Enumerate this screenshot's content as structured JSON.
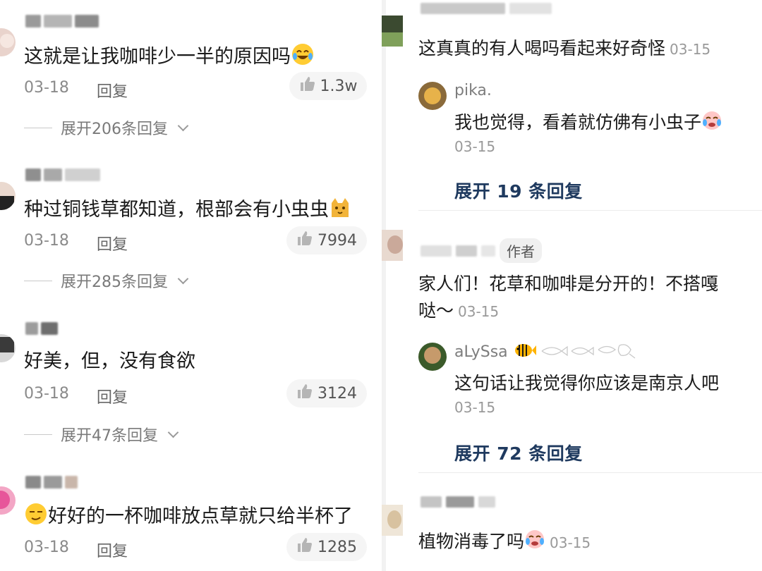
{
  "left_comments": [
    {
      "text": "这就是让我咖啡少一半的原因吗",
      "date": "03-18",
      "reply_label": "回复",
      "likes": "1.3w",
      "expand_label": "展开206条回复",
      "trailing_emoji": "laugh-cry-emoji"
    },
    {
      "text": "种过铜钱草都知道，根部会有小虫虫",
      "date": "03-18",
      "reply_label": "回复",
      "likes": "7994",
      "expand_label": "展开285条回复",
      "trailing_emoji": "cat-emoji"
    },
    {
      "text": "好美，但，没有食欲",
      "date": "03-18",
      "reply_label": "回复",
      "likes": "3124",
      "expand_label": "展开47条回复"
    },
    {
      "text": "好好的一杯咖啡放点草就只给半杯了",
      "date": "03-18",
      "reply_label": "回复",
      "likes": "1285",
      "leading_emoji": "smug-emoji"
    }
  ],
  "right_comments": [
    {
      "text": "这真真的有人喝吗看起来好奇怪",
      "date": "03-15",
      "sub_reply": {
        "username": "pika.",
        "text": "我也觉得，看着就仿佛有小虫子",
        "date": "03-15"
      },
      "expand_label": "展开 19 条回复"
    },
    {
      "author_badge": "作者",
      "text_line1": "家人们！花草和咖啡是分开的！不搭嘎",
      "text_line2": "哒～",
      "date": "03-15",
      "sub_reply": {
        "username": "aLySsa",
        "text": "这句话让我觉得你应该是南京人吧",
        "date": "03-15"
      },
      "expand_label": "展开 72 条回复"
    },
    {
      "text": "植物消毒了吗",
      "date": "03-15",
      "trailing_emoji": "crying-emoji"
    }
  ],
  "colors": {
    "expand_link": "#1f3a5f",
    "meta_gray": "#8a8a8a",
    "pill_bg": "#f5f5f5"
  }
}
